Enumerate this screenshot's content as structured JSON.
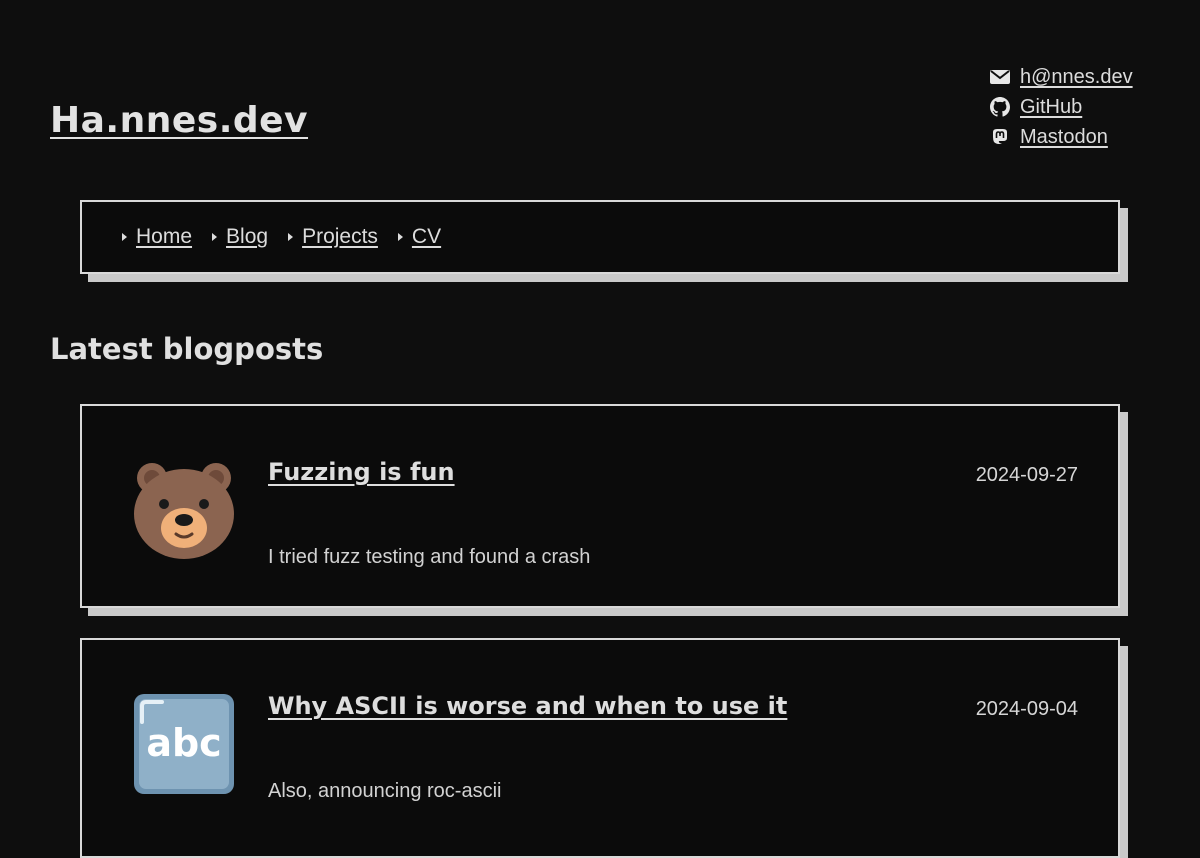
{
  "site": {
    "title": "Ha.nnes.dev"
  },
  "contact": [
    {
      "icon": "envelope-icon",
      "label": "h@nnes.dev"
    },
    {
      "icon": "github-icon",
      "label": "GitHub"
    },
    {
      "icon": "mastodon-icon",
      "label": "Mastodon"
    }
  ],
  "nav": {
    "items": [
      {
        "label": "Home"
      },
      {
        "label": "Blog"
      },
      {
        "label": "Projects"
      },
      {
        "label": "CV"
      }
    ]
  },
  "latest": {
    "heading": "Latest blogposts",
    "posts": [
      {
        "emoji": "bear-face-icon",
        "title": "Fuzzing is fun",
        "date": "2024-09-27",
        "summary": "I tried fuzz testing and found a crash"
      },
      {
        "emoji": "abc-icon",
        "title": "Why ASCII is worse and when to use it",
        "date": "2024-09-04",
        "summary": "Also, announcing roc-ascii",
        "abc_text": "abc"
      }
    ]
  },
  "colors": {
    "background": "#0e0e0e",
    "text": "#dcdcdc",
    "border": "#d9d9d9",
    "shadow": "#c9c9c9"
  }
}
